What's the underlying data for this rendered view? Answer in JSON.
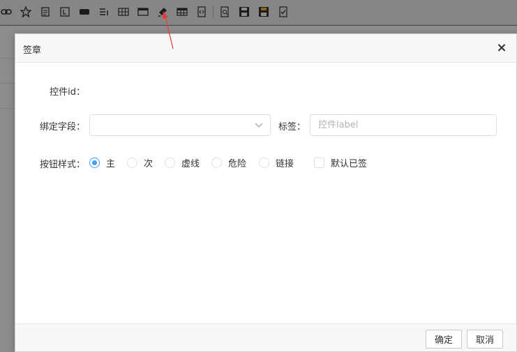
{
  "toolbar": {
    "icons": [
      "link-icon",
      "star-icon",
      "text-icon",
      "label-icon",
      "button-icon",
      "list-icon",
      "table-icon",
      "window-icon",
      "seal-pen-icon",
      "grid-table-icon",
      "code-file-icon",
      "preview-icon",
      "save-icon",
      "save-as-icon",
      "check-file-icon"
    ]
  },
  "dialog": {
    "title": "签章",
    "close_symbol": "×",
    "id_label": "控件id：",
    "id_value": "",
    "field_label": "绑定字段：",
    "field_value": "",
    "tag_label": "标签：",
    "tag_placeholder": "控件label",
    "style_label": "按钮样式：",
    "style_options": [
      {
        "label": "主",
        "checked": true
      },
      {
        "label": "次",
        "checked": false
      },
      {
        "label": "虚线",
        "checked": false
      },
      {
        "label": "危险",
        "checked": false
      },
      {
        "label": "链接",
        "checked": false
      }
    ],
    "default_signed_label": "默认已签",
    "confirm_label": "确定",
    "cancel_label": "取消"
  },
  "colors": {
    "accent": "#409eff",
    "annotation_arrow": "#e53935"
  }
}
